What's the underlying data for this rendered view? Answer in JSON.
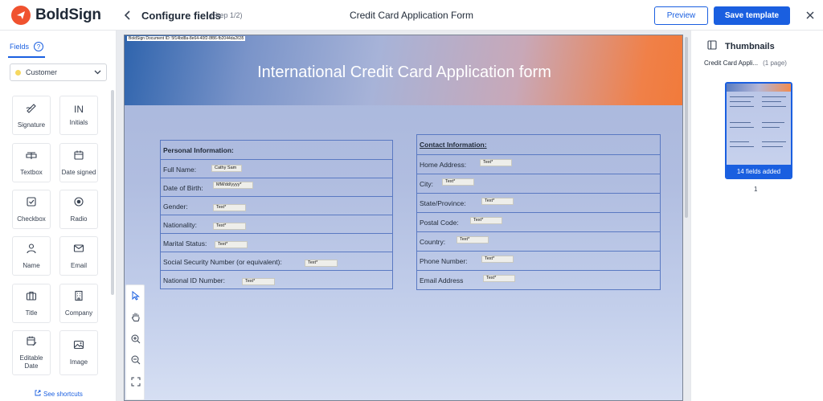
{
  "app": {
    "name": "BoldSign",
    "brand_color": "#f0522f",
    "accent_color": "#1a5fe0"
  },
  "header": {
    "title": "Configure fields",
    "step": "(Step 1/2)",
    "document_title": "Credit Card Application Form",
    "preview_label": "Preview",
    "save_label": "Save template"
  },
  "sidebar": {
    "tab_label": "Fields",
    "help_glyph": "?",
    "recipient": "Customer",
    "fields": [
      {
        "label": "Signature",
        "icon": "signature-icon"
      },
      {
        "label": "Initials",
        "icon": "initials-icon",
        "glyph": "IN"
      },
      {
        "label": "Textbox",
        "icon": "textbox-icon"
      },
      {
        "label": "Date signed",
        "icon": "calendar-icon"
      },
      {
        "label": "Checkbox",
        "icon": "checkbox-icon"
      },
      {
        "label": "Radio",
        "icon": "radio-icon"
      },
      {
        "label": "Name",
        "icon": "person-icon"
      },
      {
        "label": "Email",
        "icon": "mail-icon"
      },
      {
        "label": "Title",
        "icon": "briefcase-icon"
      },
      {
        "label": "Company",
        "icon": "building-icon"
      },
      {
        "label": "Editable Date",
        "icon": "calendar-edit-icon"
      },
      {
        "label": "Image",
        "icon": "image-icon"
      }
    ],
    "shortcuts_label": "See shortcuts"
  },
  "document": {
    "id_text": "BoldSign Document ID: 5f14bd8a-8e64-40f2-8f86-fb2044da2635",
    "banner_title": "International Credit Card Application form",
    "personal": {
      "heading": "Personal Information:",
      "rows": [
        {
          "label": "Full Name:",
          "field": "Cathy Sam"
        },
        {
          "label": "Date of Birth:",
          "field": "MM/dd/yyyy*"
        },
        {
          "label": "Gender:",
          "field": "Text*"
        },
        {
          "label": "Nationality:",
          "field": "Text*"
        },
        {
          "label": "Marital Status:",
          "field": "Text*"
        },
        {
          "label": "Social Security Number (or equivalent):",
          "field": "Text*"
        },
        {
          "label": "National ID Number:",
          "field": "Text*"
        }
      ]
    },
    "contact": {
      "heading": "Contact Information:",
      "rows": [
        {
          "label": "Home Address:",
          "field": "Text*"
        },
        {
          "label": "City:",
          "field": "Text*"
        },
        {
          "label": "State/Province:",
          "field": "Text*"
        },
        {
          "label": "Postal Code:",
          "field": "Text*"
        },
        {
          "label": "Country:",
          "field": "Text*"
        },
        {
          "label": "Phone Number:",
          "field": "Text*"
        },
        {
          "label": "Email Address",
          "field": "Text*"
        }
      ]
    }
  },
  "toolbar_icons": [
    "pointer-icon",
    "hand-icon",
    "zoom-in-icon",
    "zoom-out-icon",
    "fit-screen-icon"
  ],
  "thumbnails": {
    "heading": "Thumbnails",
    "doc_name": "Credit Card Appli...",
    "page_count": "(1 page)",
    "badge": "14 fields added",
    "page_number": "1"
  }
}
